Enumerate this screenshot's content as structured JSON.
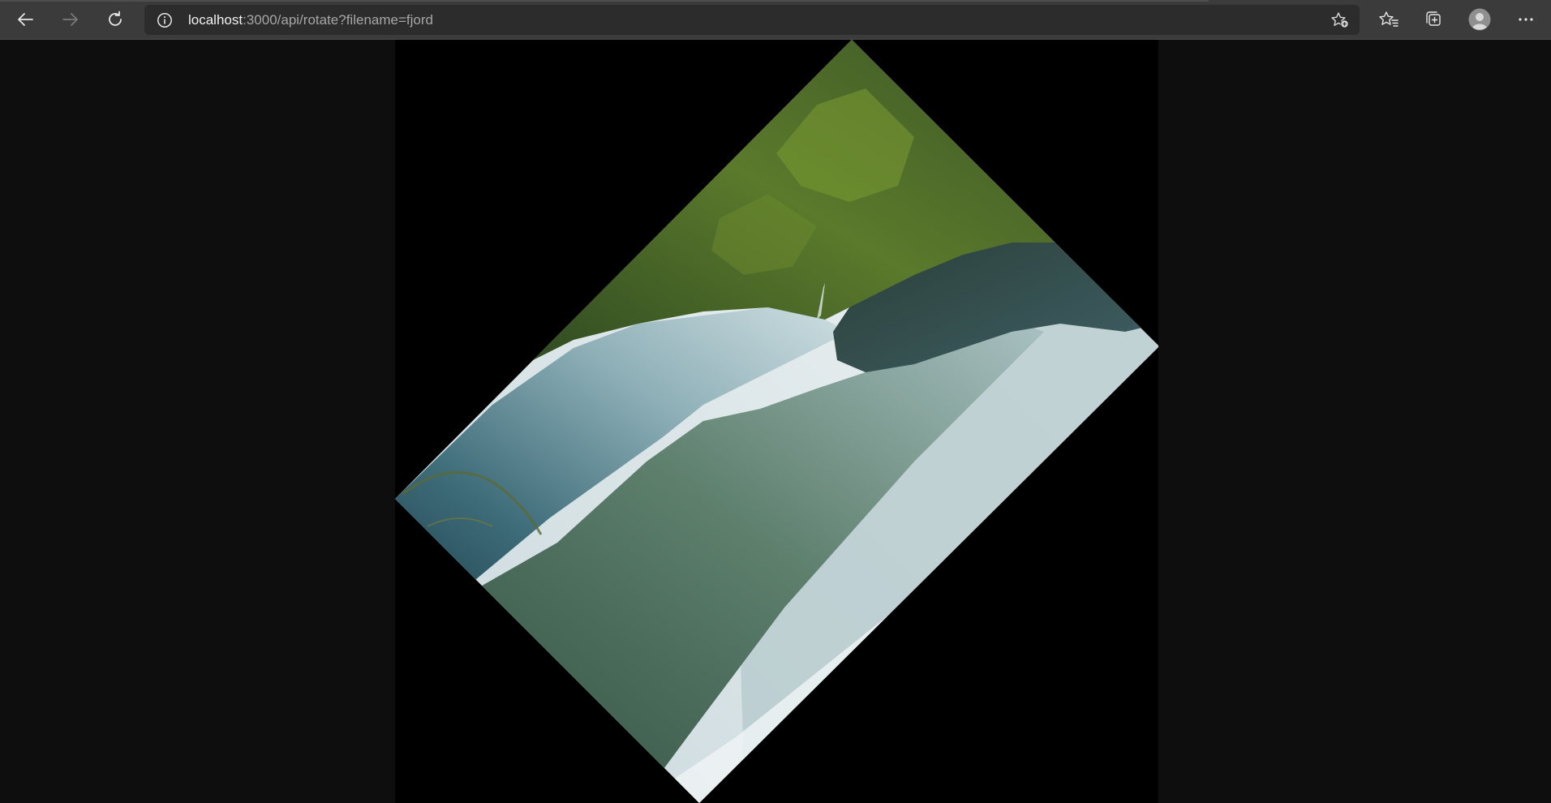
{
  "browser": {
    "address": {
      "host": "localhost",
      "rest": ":3000/api/rotate?filename=fjord"
    },
    "icons": {
      "back": "arrow-left-icon",
      "forward": "arrow-right-icon",
      "refresh": "refresh-icon",
      "site_info": "info-icon",
      "add_favorite": "star-plus-icon",
      "favorites": "favorites-icon",
      "collections": "collections-icon",
      "profile": "avatar-icon",
      "menu": "more-icon"
    },
    "colors": {
      "toolbar": "#3b3b3b",
      "address_bar": "#2c2c2c",
      "page_background": "#0e0e0e",
      "image_background": "#000000"
    }
  },
  "page": {
    "image": {
      "name": "fjord",
      "rotation_degrees": 45
    }
  }
}
